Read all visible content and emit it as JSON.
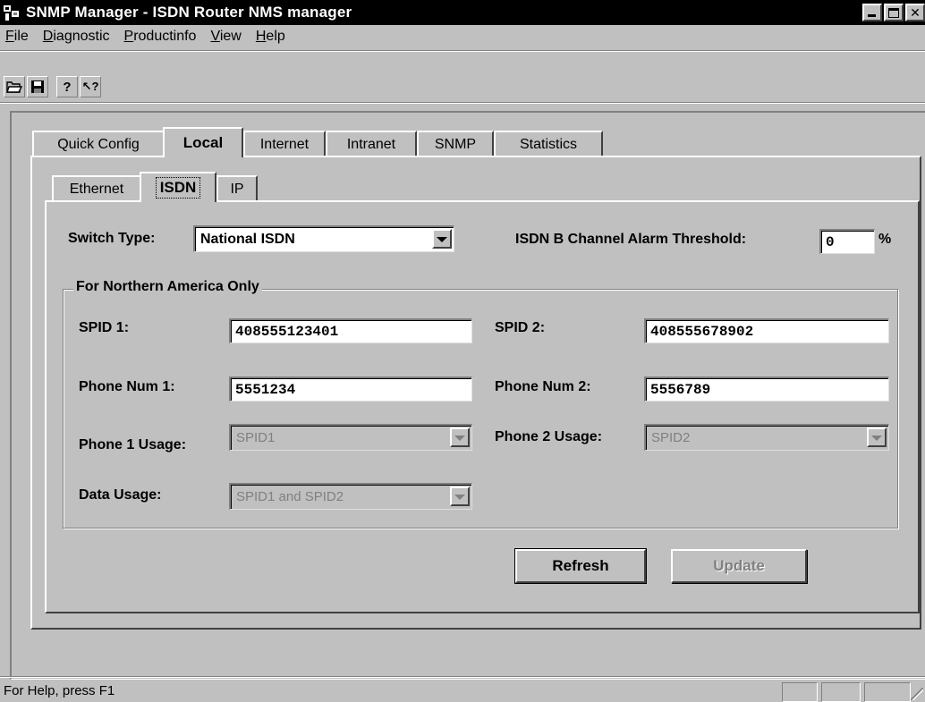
{
  "window": {
    "title": "SNMP Manager - ISDN Router NMS manager",
    "controls": {
      "minimize": "_",
      "close": "✕"
    }
  },
  "menu": [
    {
      "label": "File",
      "hotkey": "F",
      "rest": "ile"
    },
    {
      "label": "Diagnostic",
      "hotkey": "D",
      "rest": "iagnostic"
    },
    {
      "label": "Productinfo",
      "hotkey": "P",
      "rest": "roductinfo"
    },
    {
      "label": "View",
      "hotkey": "V",
      "rest": "iew"
    },
    {
      "label": "Help",
      "hotkey": "H",
      "rest": "elp"
    }
  ],
  "toolbar": {
    "buttons": [
      {
        "name": "open-icon",
        "glyph": "📂"
      },
      {
        "name": "save-icon",
        "glyph": "💾"
      },
      {
        "name": "about-icon",
        "glyph": "?"
      },
      {
        "name": "context-help-icon",
        "glyph": "↖?"
      }
    ]
  },
  "main_tabs": [
    "Quick Config",
    "Local",
    "Internet",
    "Intranet",
    "SNMP",
    "Statistics"
  ],
  "main_active_tab": "Local",
  "sub_tabs": [
    "Ethernet",
    "ISDN",
    "IP"
  ],
  "sub_active_tab": "ISDN",
  "form": {
    "switch_type_label": "Switch Type:",
    "switch_type_value": "National ISDN",
    "threshold_label": "ISDN B Channel Alarm Threshold:",
    "threshold_value": "0",
    "threshold_unit": "%",
    "group_title": "For Northern America Only",
    "spid1_label": "SPID 1:",
    "spid1_value": "408555123401",
    "spid2_label": "SPID 2:",
    "spid2_value": "408555678902",
    "phone1_label": "Phone Num 1:",
    "phone1_value": "5551234",
    "phone2_label": "Phone Num 2:",
    "phone2_value": "5556789",
    "phone1_usage_label": "Phone 1 Usage:",
    "phone1_usage_value": "SPID1",
    "phone2_usage_label": "Phone 2 Usage:",
    "phone2_usage_value": "SPID2",
    "data_usage_label": "Data Usage:",
    "data_usage_value": "SPID1 and SPID2"
  },
  "buttons": {
    "refresh": "Refresh",
    "update": "Update"
  },
  "status": {
    "text": "For Help, press F1"
  }
}
